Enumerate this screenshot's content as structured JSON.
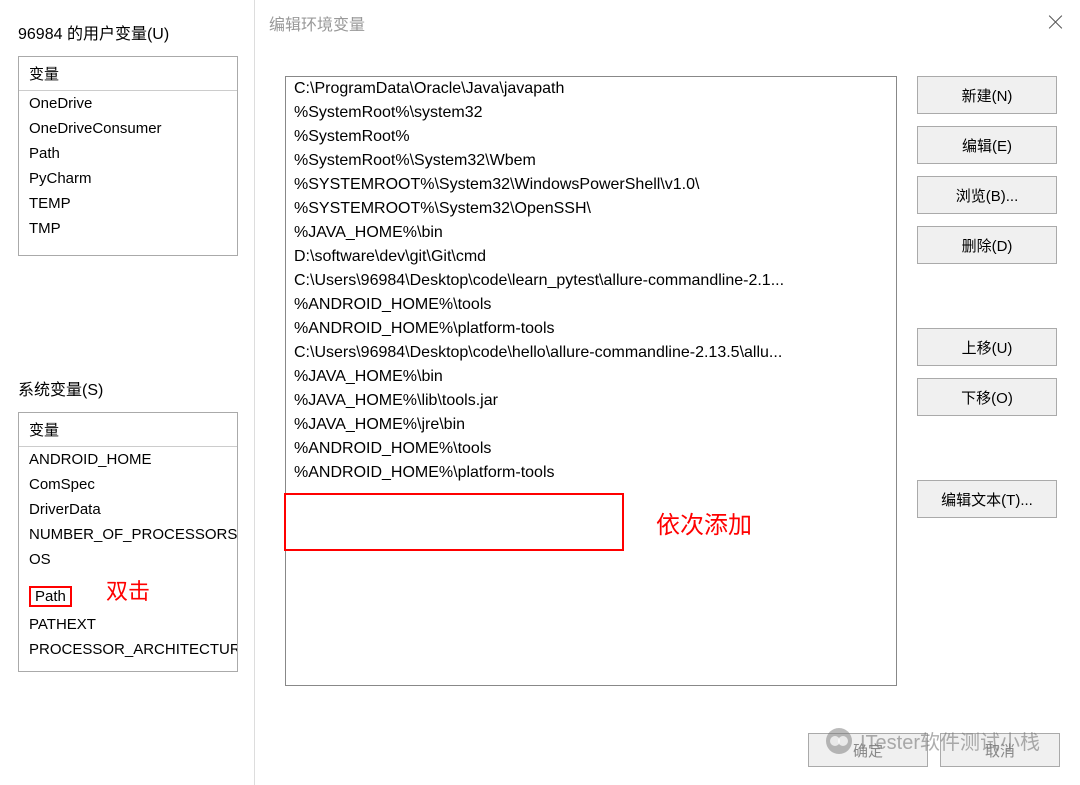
{
  "back": {
    "user_section_label": "96984 的用户变量(U)",
    "sys_section_label": "系统变量(S)",
    "var_header": "变量",
    "user_vars": [
      "OneDrive",
      "OneDriveConsumer",
      "Path",
      "PyCharm",
      "TEMP",
      "TMP"
    ],
    "sys_vars": [
      "ANDROID_HOME",
      "ComSpec",
      "DriverData",
      "NUMBER_OF_PROCESSORS",
      "OS",
      "Path",
      "PATHEXT",
      "PROCESSOR_ARCHITECTURE"
    ],
    "dbl_click_label": "双击"
  },
  "dialog": {
    "title": "编辑环境变量",
    "paths": [
      "C:\\ProgramData\\Oracle\\Java\\javapath",
      "%SystemRoot%\\system32",
      "%SystemRoot%",
      "%SystemRoot%\\System32\\Wbem",
      "%SYSTEMROOT%\\System32\\WindowsPowerShell\\v1.0\\",
      "%SYSTEMROOT%\\System32\\OpenSSH\\",
      "%JAVA_HOME%\\bin",
      "D:\\software\\dev\\git\\Git\\cmd",
      "C:\\Users\\96984\\Desktop\\code\\learn_pytest\\allure-commandline-2.1...",
      "%ANDROID_HOME%\\tools",
      "%ANDROID_HOME%\\platform-tools",
      "C:\\Users\\96984\\Desktop\\code\\hello\\allure-commandline-2.13.5\\allu...",
      "%JAVA_HOME%\\bin",
      "%JAVA_HOME%\\lib\\tools.jar",
      "%JAVA_HOME%\\jre\\bin",
      "%ANDROID_HOME%\\tools",
      "%ANDROID_HOME%\\platform-tools"
    ],
    "add_label": "依次添加",
    "buttons": {
      "new": "新建(N)",
      "edit": "编辑(E)",
      "browse": "浏览(B)...",
      "delete": "删除(D)",
      "up": "上移(U)",
      "down": "下移(O)",
      "edit_text": "编辑文本(T)..."
    },
    "footer": {
      "ok": "确定",
      "cancel": "取消"
    }
  },
  "watermark": "ITester软件测试小栈"
}
